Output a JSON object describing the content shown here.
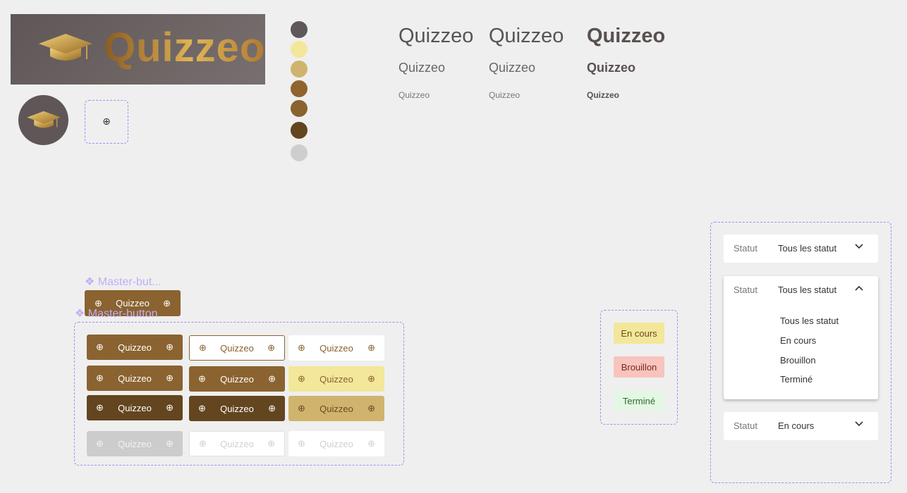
{
  "brand": {
    "name": "Quizzeo"
  },
  "colors": {
    "palette": [
      "#605758",
      "#f3e79a",
      "#d0b46d",
      "#8f642f",
      "#8a6330",
      "#63451f",
      "#cecece"
    ]
  },
  "typography": {
    "samples": [
      "Quizzeo",
      "Quizzeo",
      "Quizzeo",
      "Quizzeo",
      "Quizzeo",
      "Quizzeo",
      "Quizzeo",
      "Quizzeo",
      "Quizzeo"
    ]
  },
  "add_icon": "⊕",
  "components": {
    "master_button_label_1": "❖ Master-but...",
    "master_button_label_2": "❖ Master-button",
    "master_button_text": "Quizzeo",
    "buttons": {
      "text": "Quizzeo"
    }
  },
  "status_pills": {
    "en_cours": "En cours",
    "brouillon": "Brouillon",
    "termine": "Terminé"
  },
  "status_filters": {
    "label": "Statut",
    "closed_value": "Tous les statut",
    "open_value": "Tous les statut",
    "options": [
      "Tous les statut",
      "En cours",
      "Brouillon",
      "Terminé"
    ],
    "selected_value": "En cours"
  }
}
